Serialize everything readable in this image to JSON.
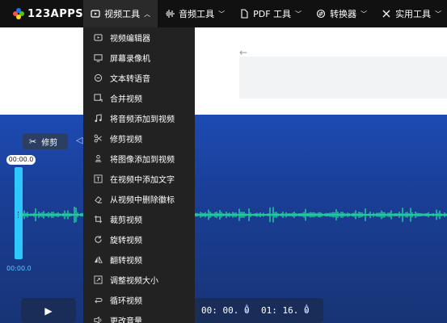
{
  "logo": {
    "text": "123APPS",
    "colors": [
      "#ff4d4f",
      "#1677ff",
      "#52c41a",
      "#fadb14"
    ]
  },
  "nav": [
    {
      "label": "视频工具",
      "icon": "video-icon",
      "active": true,
      "chevron": "up"
    },
    {
      "label": "音频工具",
      "icon": "audio-wave-icon",
      "active": false,
      "chevron": "down"
    },
    {
      "label": "PDF 工具",
      "icon": "pdf-icon",
      "active": false,
      "chevron": "down"
    },
    {
      "label": "转换器",
      "icon": "convert-icon",
      "active": false,
      "chevron": "down"
    },
    {
      "label": "实用工具",
      "icon": "tools-icon",
      "active": false,
      "chevron": "down"
    }
  ],
  "video_menu": [
    {
      "label": "视频编辑器",
      "icon": "video-editor-icon"
    },
    {
      "label": "屏幕录像机",
      "icon": "monitor-icon"
    },
    {
      "label": "文本转语音",
      "icon": "text-to-speech-icon"
    },
    {
      "label": "合并视频",
      "icon": "merge-icon"
    },
    {
      "label": "将音频添加到视频",
      "icon": "music-note-icon"
    },
    {
      "label": "修剪视频",
      "icon": "scissors-icon"
    },
    {
      "label": "将图像添加到视频",
      "icon": "image-stamp-icon"
    },
    {
      "label": "在视频中添加文字",
      "icon": "text-icon"
    },
    {
      "label": "从视频中删除徽标",
      "icon": "eraser-icon"
    },
    {
      "label": "裁剪视频",
      "icon": "crop-icon"
    },
    {
      "label": "旋转视频",
      "icon": "rotate-icon"
    },
    {
      "label": "翻转视频",
      "icon": "flip-icon"
    },
    {
      "label": "调整视频大小",
      "icon": "resize-icon"
    },
    {
      "label": "循环视频",
      "icon": "loop-icon"
    },
    {
      "label": "更改音量",
      "icon": "volume-icon"
    }
  ],
  "editor": {
    "trim_label": "修剪",
    "start_marker": "00:00.0",
    "start_time_bottom": "00:00.0",
    "start_time": "00: 00. 0",
    "end_time": "01: 16. 0",
    "waveform_color": "#22e0a1",
    "handle_color": "#2ec8ff",
    "back_arrow": "←"
  }
}
